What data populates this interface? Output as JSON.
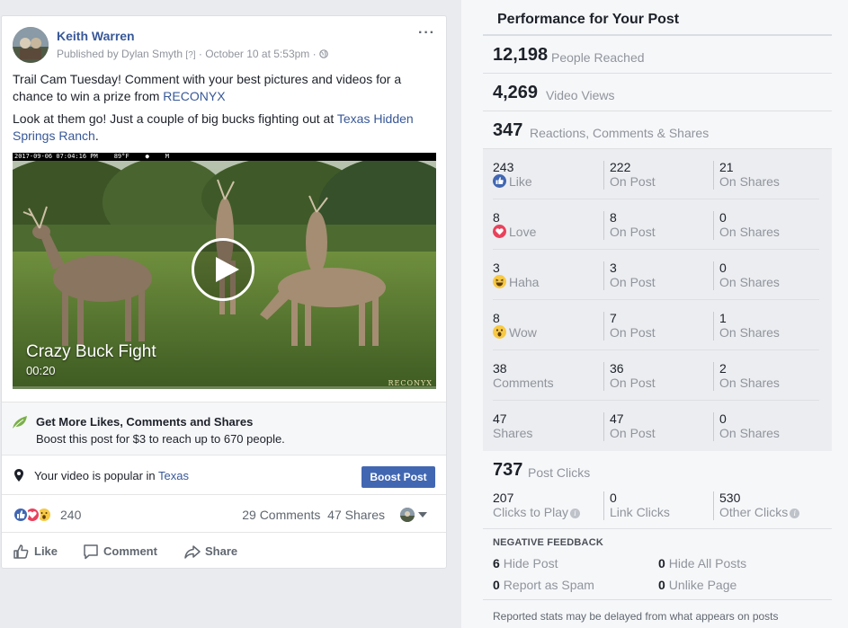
{
  "post": {
    "author": "Keith Warren",
    "published_by": "Published by Dylan Smyth",
    "help_mark": "[?]",
    "date": "October 10 at 5:53pm",
    "more_icon": "more-dots-icon",
    "text_line1": "Trail Cam Tuesday! Comment with your best pictures and videos for a chance to win a prize from ",
    "text_link1": "RECONYX",
    "text_line2": "Look at them go! Just a couple of big bucks fighting out at ",
    "text_link2": "Texas Hidden Springs Ranch",
    "text_line2_end": ".",
    "video": {
      "cam_date": "2017-09-06 07:04:16 PM",
      "cam_temp": "89°F",
      "cam_moon": "●",
      "cam_mode": "M",
      "title": "Crazy Buck Fight",
      "duration": "00:20",
      "watermark": "RECONYX",
      "progress": 0
    },
    "boost_box": {
      "title": "Get More Likes, Comments and Shares",
      "description": "Boost this post for $3 to reach up to 670 people."
    },
    "popular": {
      "text": "Your video is popular in ",
      "location": "Texas",
      "button": "Boost Post"
    },
    "reactions": {
      "count": "240",
      "comments": "29 Comments",
      "shares": "47 Shares"
    },
    "actions": {
      "like": "Like",
      "comment": "Comment",
      "share": "Share"
    }
  },
  "panel": {
    "title": "Performance for Your Post",
    "people_reached": {
      "num": "12,198",
      "label": "People Reached"
    },
    "video_views": {
      "num": "4,269",
      "label": "Video Views"
    },
    "engagement": {
      "num": "347",
      "label": "Reactions, Comments & Shares"
    },
    "rows": [
      {
        "total": "243",
        "label": "Like",
        "icon": "like-reaction-icon",
        "on_post": "222",
        "on_post_label": "On Post",
        "on_shares": "21",
        "on_shares_label": "On Shares"
      },
      {
        "total": "8",
        "label": "Love",
        "icon": "love-reaction-icon",
        "on_post": "8",
        "on_post_label": "On Post",
        "on_shares": "0",
        "on_shares_label": "On Shares"
      },
      {
        "total": "3",
        "label": "Haha",
        "icon": "haha-reaction-icon",
        "on_post": "3",
        "on_post_label": "On Post",
        "on_shares": "0",
        "on_shares_label": "On Shares"
      },
      {
        "total": "8",
        "label": "Wow",
        "icon": "wow-reaction-icon",
        "on_post": "7",
        "on_post_label": "On Post",
        "on_shares": "1",
        "on_shares_label": "On Shares"
      },
      {
        "total": "38",
        "label": "Comments",
        "icon": "",
        "on_post": "36",
        "on_post_label": "On Post",
        "on_shares": "2",
        "on_shares_label": "On Shares"
      },
      {
        "total": "47",
        "label": "Shares",
        "icon": "",
        "on_post": "47",
        "on_post_label": "On Post",
        "on_shares": "0",
        "on_shares_label": "On Shares"
      }
    ],
    "post_clicks": {
      "num": "737",
      "label": "Post Clicks"
    },
    "clicks": [
      {
        "num": "207",
        "label": "Clicks to Play"
      },
      {
        "num": "0",
        "label": "Link Clicks"
      },
      {
        "num": "530",
        "label": "Other Clicks"
      }
    ],
    "negative": {
      "title": "NEGATIVE FEEDBACK",
      "hide_post": {
        "num": "6",
        "label": "Hide Post"
      },
      "hide_all": {
        "num": "0",
        "label": "Hide All Posts"
      },
      "spam": {
        "num": "0",
        "label": "Report as Spam"
      },
      "unlike": {
        "num": "0",
        "label": "Unlike Page"
      }
    },
    "footnote": "Reported stats may be delayed from what appears on posts"
  },
  "colors": {
    "link": "#385898",
    "button": "#4267b2",
    "like": "#4267b2",
    "love": "#e9425c",
    "haha": "#f7c945"
  }
}
